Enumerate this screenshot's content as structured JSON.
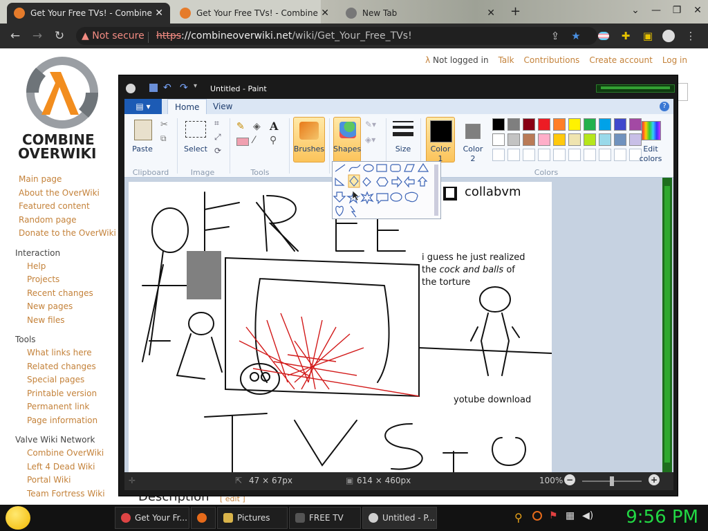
{
  "browser": {
    "tabs": [
      {
        "title": "Get Your Free TVs! - Combine O",
        "active": true
      },
      {
        "title": "Get Your Free TVs! - Combine O",
        "active": false
      },
      {
        "title": "New Tab",
        "active": false
      }
    ],
    "new_tab": "+",
    "security_label": "Not secure",
    "url_scheme": "https",
    "url_rest": "://combineoverwiki.net",
    "url_path": "/wiki/Get_Your_Free_TVs!"
  },
  "wiki": {
    "logo_line1": "COMBINE",
    "logo_line2": "OVERWIKI",
    "personal": {
      "not_logged_in": "Not logged in",
      "talk": "Talk",
      "contributions": "Contributions",
      "create_account": "Create account",
      "log_in": "Log in"
    },
    "nav": [
      "Main page",
      "About the OverWiki",
      "Featured content",
      "Random page",
      "Donate to the OverWiki"
    ],
    "interaction_heading": "Interaction",
    "interaction": [
      "Help",
      "Projects",
      "Recent changes",
      "New pages",
      "New files"
    ],
    "tools_heading": "Tools",
    "tools": [
      "What links here",
      "Related changes",
      "Special pages",
      "Printable version",
      "Permanent link",
      "Page information"
    ],
    "network_heading": "Valve Wiki Network",
    "network": [
      "Combine OverWiki",
      "Left 4 Dead Wiki",
      "Portal Wiki",
      "Team Fortress Wiki"
    ],
    "section_heading": "Description",
    "section_edit": "[ edit ]"
  },
  "paint": {
    "title": "Untitled - Paint",
    "file_tab": "",
    "tabs": [
      "Home",
      "View"
    ],
    "clipboard": {
      "paste": "Paste",
      "group": "Clipboard"
    },
    "image": {
      "select": "Select",
      "group": "Image"
    },
    "tools": {
      "group": "Tools"
    },
    "brushes": "Brushes",
    "shapes": "Shapes",
    "size": "Size",
    "color1": "Color",
    "color1_num": "1",
    "color2": "Color",
    "color2_num": "2",
    "colors_group": "Colors",
    "edit_colors": "Edit",
    "edit_colors2": "colors",
    "palette_row1": [
      "#000000",
      "#7f7f7f",
      "#880015",
      "#ed1c24",
      "#ff7f27",
      "#fff200",
      "#22b14c",
      "#00a2e8",
      "#3f48cc",
      "#a349a4"
    ],
    "palette_row2": [
      "#ffffff",
      "#c3c3c3",
      "#b97a57",
      "#ffaec9",
      "#ffc90e",
      "#efe4b0",
      "#b5e61d",
      "#99d9ea",
      "#7092be",
      "#c8bfe7"
    ],
    "status": {
      "cursor": "47 × 67px",
      "size": "614 × 460px",
      "zoom": "100%"
    },
    "canvas_texts": {
      "collabvm": "collabvm",
      "line1": "i guess he just realized",
      "line2a": "the ",
      "line2b": "cock and balls",
      "line2c": " of",
      "line3": "the torture",
      "youtube": "yotube download"
    }
  },
  "taskbar": {
    "items": [
      "Get Your Fr...",
      "",
      "Pictures",
      "FREE TV",
      "Untitled - P..."
    ],
    "clock": "9:56 PM"
  }
}
